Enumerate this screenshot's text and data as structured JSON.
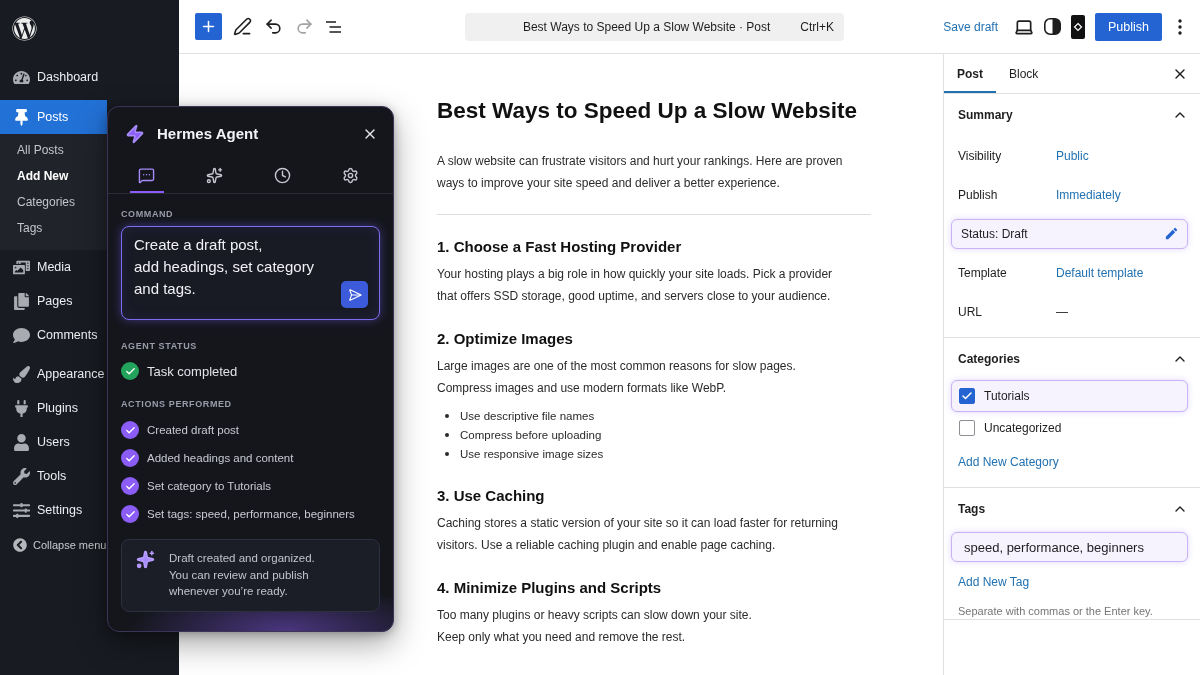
{
  "admin_menu": {
    "groups": [
      [
        {
          "label": "Dashboard",
          "selected": false
        }
      ],
      [
        {
          "label": "Posts",
          "selected": true,
          "children": [
            {
              "label": "All Posts",
              "selected": false
            },
            {
              "label": "Add New",
              "selected": true
            },
            {
              "label": "Categories",
              "selected": false
            },
            {
              "label": "Tags",
              "selected": false
            }
          ]
        },
        {
          "label": "Media",
          "selected": false
        },
        {
          "label": "Pages",
          "selected": false
        },
        {
          "label": "Comments",
          "selected": false
        }
      ],
      [
        {
          "label": "Appearance",
          "selected": false
        },
        {
          "label": "Plugins",
          "selected": false
        },
        {
          "label": "Users",
          "selected": false
        },
        {
          "label": "Tools",
          "selected": false
        },
        {
          "label": "Settings",
          "selected": false
        }
      ]
    ],
    "collapse": "Collapse menu"
  },
  "toolbar": {
    "undo": {
      "disabled": false
    },
    "redo": {
      "disabled": true
    },
    "document_title": "Best Ways to Speed Up a Slow Website · Post",
    "shortcut": "Ctrl+K",
    "save_draft": "Save draft",
    "publish": "Publish"
  },
  "agent_panel": {
    "title": "Hermes Agent",
    "tabs": [
      {
        "kind": "chat",
        "selected": true
      },
      {
        "kind": "sparkles",
        "selected": false
      },
      {
        "kind": "history",
        "selected": false
      },
      {
        "kind": "settings",
        "selected": false
      }
    ],
    "command": {
      "label": "COMMAND",
      "value": "Create a draft post,\nadd headings, set category\nand tags."
    },
    "status": {
      "label": "AGENT STATUS",
      "kind": "success",
      "text": "Task completed"
    },
    "actions": {
      "label": "ACTIONS PERFORMED",
      "items": [
        {
          "text": "Created draft post",
          "done": true
        },
        {
          "text": "Added headings and content",
          "done": true
        },
        {
          "text": "Set category to Tutorials",
          "done": true
        },
        {
          "text": "Set tags: speed, performance, beginners",
          "done": true
        }
      ]
    },
    "note": "Draft created and organized.\nYou can review and publish\nwhenever you’re ready."
  },
  "post": {
    "title": "Best Ways to Speed Up a Slow Website",
    "blocks": [
      {
        "kind": "paragraph",
        "text": "A slow website can frustrate visitors and hurt your rankings. Here are proven\nways to improve your site speed and deliver a better experience."
      },
      {
        "kind": "separator"
      },
      {
        "kind": "heading",
        "text": "1. Choose a Fast Hosting Provider"
      },
      {
        "kind": "paragraph",
        "text": "Your hosting plays a big role in how quickly your site loads. Pick a provider\nthat offers SSD storage, good uptime, and servers close to your audience."
      },
      {
        "kind": "heading",
        "text": "2. Optimize Images"
      },
      {
        "kind": "paragraph",
        "text": "Large images are one of the most common reasons for slow pages.\nCompress images and use modern formats like WebP."
      },
      {
        "kind": "list",
        "items": [
          "Use descriptive file names",
          "Compress before uploading",
          "Use responsive image sizes"
        ]
      },
      {
        "kind": "heading",
        "text": "3. Use Caching"
      },
      {
        "kind": "paragraph",
        "text": "Caching stores a static version of your site so it can load faster for returning\nvisitors. Use a reliable caching plugin and enable page caching."
      },
      {
        "kind": "heading",
        "text": "4. Minimize Plugins and Scripts"
      },
      {
        "kind": "paragraph",
        "text": "Too many plugins or heavy scripts can slow down your site.\nKeep only what you need and remove the rest."
      }
    ]
  },
  "settings_panel": {
    "tabs": [
      {
        "label": "Post",
        "selected": true
      },
      {
        "label": "Block",
        "selected": false
      }
    ],
    "sections": [
      {
        "kind": "summary",
        "title": "Summary",
        "expanded": true,
        "rows": [
          {
            "kind": "link",
            "label": "Visibility",
            "value": "Public"
          },
          {
            "kind": "link",
            "label": "Publish",
            "value": "Immediately"
          },
          {
            "kind": "status",
            "text": "Status: Draft",
            "highlighted": true
          },
          {
            "kind": "link",
            "label": "Template",
            "value": "Default template"
          },
          {
            "kind": "text",
            "label": "URL",
            "value": "—"
          }
        ]
      },
      {
        "kind": "categories",
        "title": "Categories",
        "expanded": true,
        "items": [
          {
            "label": "Tutorials",
            "checked": true,
            "highlighted": true
          },
          {
            "label": "Uncategorized",
            "checked": false,
            "highlighted": false
          }
        ],
        "add_link": "Add New Category"
      },
      {
        "kind": "tags",
        "title": "Tags",
        "expanded": true,
        "value": "speed, performance, beginners",
        "highlighted": true,
        "add_link": "Add New Tag",
        "help": "Separate with commas or the Enter key."
      }
    ]
  }
}
